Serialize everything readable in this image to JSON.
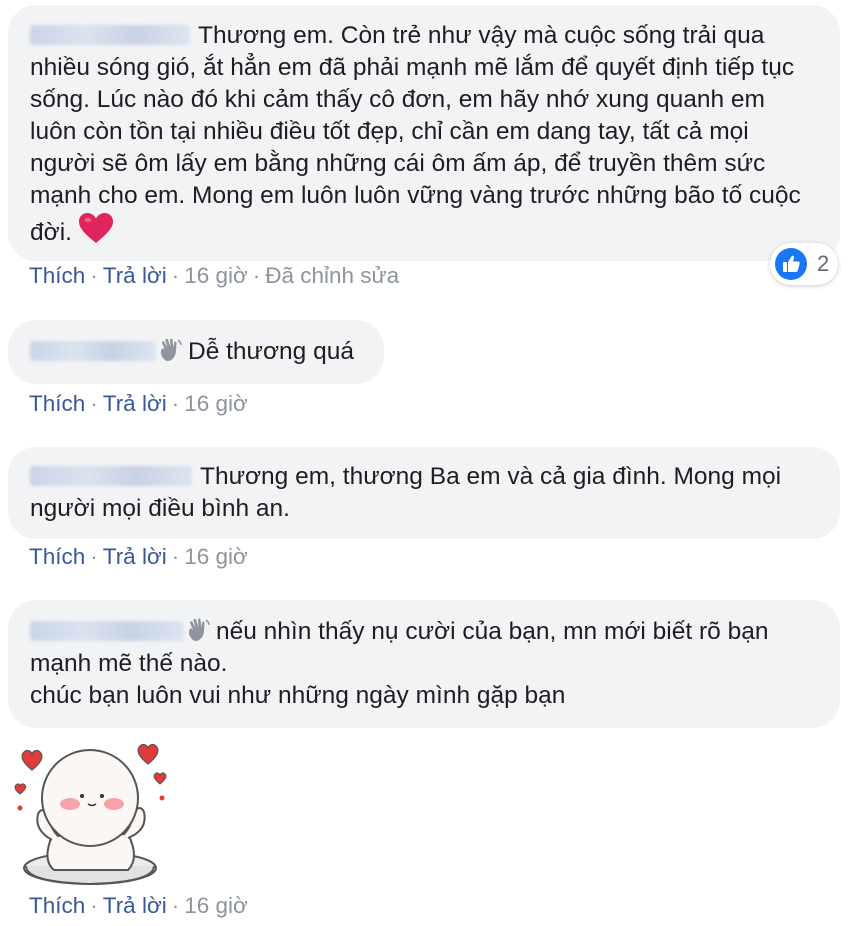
{
  "comments": [
    {
      "text": "Thương em. Còn trẻ như vậy mà cuộc sống trải qua nhiều sóng gió, ắt hẳn em đã phải mạnh mẽ lắm để quyết định tiếp tục sống. Lúc nào đó khi cảm thấy cô đơn, em hãy nhớ xung quanh em luôn còn tồn tại nhiều điều tốt đẹp, chỉ cần em dang tay, tất cả mọi người sẽ ôm lấy em bằng những cái ôm ấm áp, để truyền thêm sức mạnh cho em. Mong em luôn luôn vững vàng trước những bão tố cuộc đời.",
      "like": "Thích",
      "reply": "Trả lời",
      "time": "16 giờ",
      "edited": "Đã chỉnh sửa",
      "reaction_count": "2"
    },
    {
      "text": "Dễ thương quá",
      "like": "Thích",
      "reply": "Trả lời",
      "time": "16 giờ"
    },
    {
      "text": "Thương em, thương Ba em và cả gia đình. Mong mọi người mọi điều bình an.",
      "like": "Thích",
      "reply": "Trả lời",
      "time": "16 giờ"
    },
    {
      "text_line1": "nếu nhìn thấy nụ cười của bạn, mn mới biết rõ bạn mạnh mẽ thế nào.",
      "text_line2": "chúc bạn luôn vui như những ngày mình gặp bạn",
      "like": "Thích",
      "reply": "Trả lời",
      "time": "16 giờ"
    },
    {
      "like": "Thích",
      "reply": "Trả lời",
      "time": "16 giờ"
    }
  ],
  "icons": {
    "like": "thumbs-up-icon",
    "heart": "red-heart-emoji",
    "wave": "waving-hand-emoji",
    "sticker": "blushing-character-sticker"
  },
  "colors": {
    "bubble": "#f2f3f5",
    "link": "#385898",
    "meta": "#8d949e",
    "like_blue": "#1877f2",
    "heart_red": "#e0245e"
  }
}
